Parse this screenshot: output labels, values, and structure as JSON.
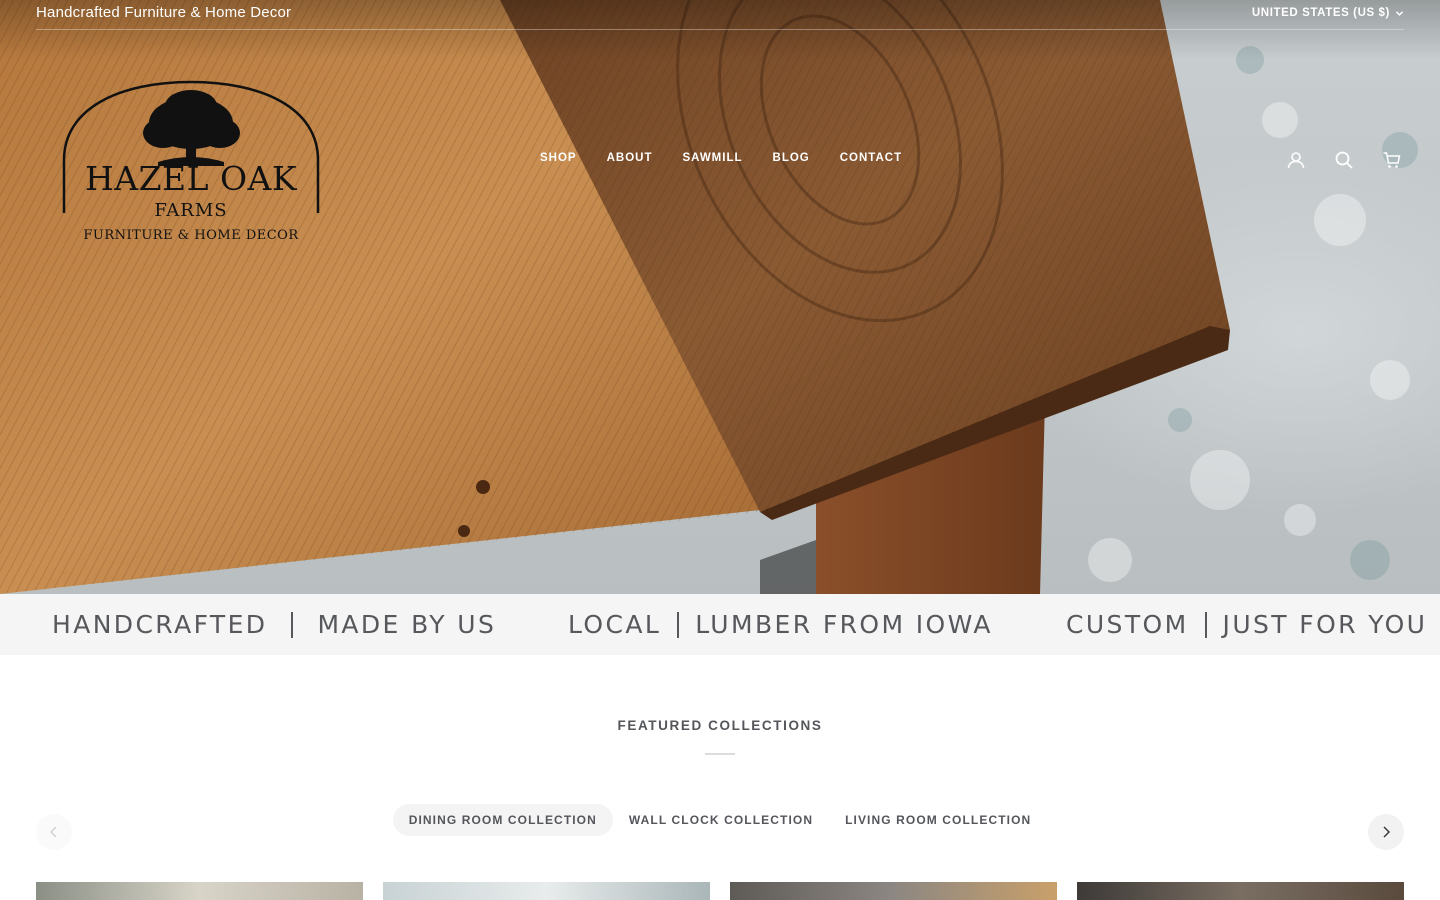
{
  "announcement": {
    "text": "Handcrafted Furniture & Home Decor"
  },
  "currency": {
    "label": "UNITED STATES (US $)"
  },
  "logo": {
    "line1": "HAZEL OAK",
    "line2": "FARMS",
    "line3": "FURNITURE & HOME DECOR"
  },
  "nav": {
    "items": [
      "SHOP",
      "ABOUT",
      "SAWMILL",
      "BLOG",
      "CONTACT"
    ]
  },
  "header_icons": [
    "account-icon",
    "search-icon",
    "cart-icon"
  ],
  "strip": [
    {
      "left": "HANDCRAFTED",
      "right": "MADE BY US"
    },
    {
      "left": "LOCAL",
      "right": "LUMBER FROM IOWA"
    },
    {
      "left": "CUSTOM",
      "right": "JUST FOR YOU"
    }
  ],
  "featured": {
    "title": "FEATURED COLLECTIONS",
    "tabs": [
      "DINING ROOM COLLECTION",
      "WALL CLOCK COLLECTION",
      "LIVING ROOM COLLECTION"
    ],
    "active_tab": "DINING ROOM COLLECTION"
  },
  "colors": {
    "text": "#54565b",
    "strip_bg": "#f5f5f5",
    "wood_light": "#c98d4c",
    "wood_dark": "#7a4a26"
  }
}
